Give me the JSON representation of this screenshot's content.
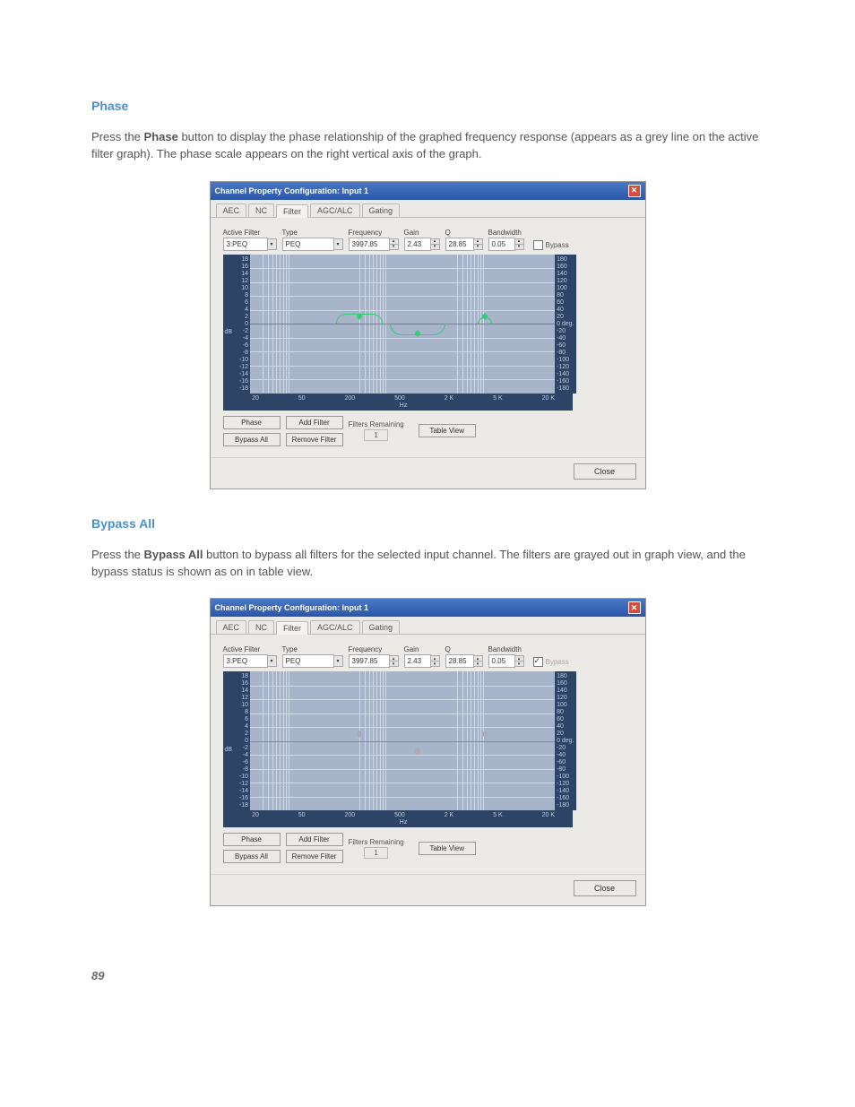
{
  "page_number": "89",
  "sections": [
    {
      "title": "Phase",
      "text_before_bold": "Press the ",
      "bold": "Phase",
      "text_after_bold": " button to display the phase relationship of the graphed frequency response (appears as a grey line on the active filter graph). The phase scale appears on the right vertical axis of the graph."
    },
    {
      "title": "Bypass All",
      "text_before_bold": "Press the ",
      "bold": "Bypass All",
      "text_after_bold": " button to bypass all filters for the selected input channel. The filters are grayed out in graph view, and the bypass status is shown as on in table view."
    }
  ],
  "dialog": {
    "title": "Channel Property Configuration: Input 1",
    "tabs": [
      "AEC",
      "NC",
      "Filter",
      "AGC/ALC",
      "Gating"
    ],
    "active_tab": 2,
    "controls": {
      "active_filter": {
        "label": "Active Filter",
        "value": "3:PEQ"
      },
      "type": {
        "label": "Type",
        "value": "PEQ"
      },
      "frequency": {
        "label": "Frequency",
        "value": "3997.85"
      },
      "gain": {
        "label": "Gain",
        "value": "2.43"
      },
      "q": {
        "label": "Q",
        "value": "28.85"
      },
      "bandwidth": {
        "label": "Bandwidth",
        "value": "0.05"
      },
      "bypass_label": "Bypass"
    },
    "y_left_label": "dB",
    "y_left_ticks": [
      "18",
      "16",
      "14",
      "12",
      "10",
      "8",
      "6",
      "4",
      "2",
      "0",
      "-2",
      "-4",
      "-6",
      "-8",
      "-10",
      "-12",
      "-14",
      "-16",
      "-18"
    ],
    "y_right_ticks": [
      "180",
      "160",
      "140",
      "120",
      "100",
      "80",
      "60",
      "40",
      "20",
      "0 deg.",
      "-20",
      "-40",
      "-60",
      "-80",
      "-100",
      "-120",
      "-140",
      "-160",
      "-180"
    ],
    "x_ticks": [
      "20",
      "50",
      "200",
      "500",
      "2 K",
      "5 K",
      "20 K"
    ],
    "x_label": "Hz",
    "buttons": {
      "phase": "Phase",
      "bypass_all": "Bypass All",
      "add_filter": "Add Filter",
      "remove_filter": "Remove Filter",
      "filters_remaining_label": "Filters Remaining",
      "filters_remaining_value": "1",
      "table_view": "Table View",
      "close": "Close"
    }
  }
}
